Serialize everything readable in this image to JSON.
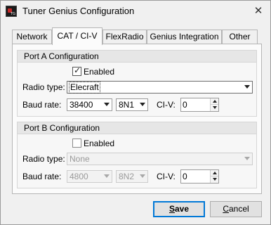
{
  "window": {
    "title": "Tuner Genius Configuration",
    "close_glyph": "✕",
    "icon_text": "TG"
  },
  "tabs": [
    {
      "label": "Network"
    },
    {
      "label": "CAT / CI-V"
    },
    {
      "label": "FlexRadio"
    },
    {
      "label": "Genius Integration"
    },
    {
      "label": "Other"
    }
  ],
  "active_tab": "CAT / CI-V",
  "port_a": {
    "header": "Port A Configuration",
    "enabled_label": "Enabled",
    "enabled": true,
    "check_glyph": "✓",
    "radio_type_label": "Radio type:",
    "radio_type": "Elecraft",
    "baud_rate_label": "Baud rate:",
    "baud_rate": "38400",
    "format": "8N1",
    "civ_label": "CI-V:",
    "civ": "0"
  },
  "port_b": {
    "header": "Port B Configuration",
    "enabled_label": "Enabled",
    "enabled": false,
    "radio_type_label": "Radio type:",
    "radio_type": "None",
    "baud_rate_label": "Baud rate:",
    "baud_rate": "4800",
    "format": "8N2",
    "civ_label": "CI-V:",
    "civ": "0"
  },
  "buttons": {
    "save_first": "S",
    "save_rest": "ave",
    "cancel_first": "C",
    "cancel_rest": "ancel"
  }
}
